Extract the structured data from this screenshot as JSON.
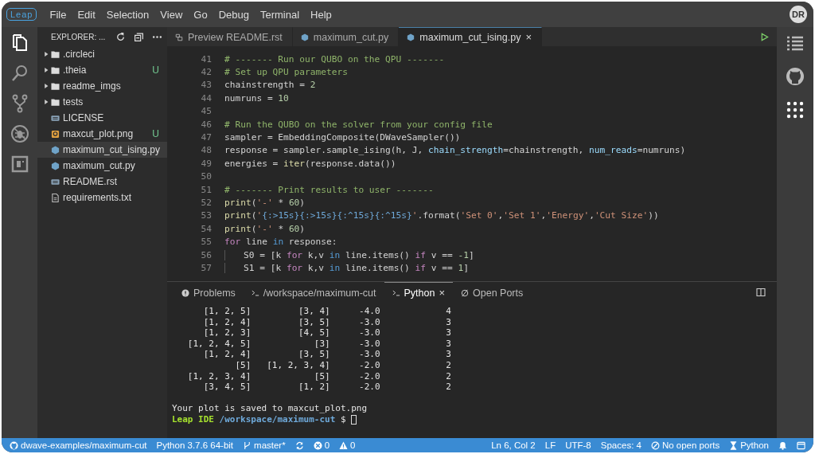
{
  "title_bar": {
    "logo": "Leap",
    "menu": [
      "File",
      "Edit",
      "Selection",
      "View",
      "Go",
      "Debug",
      "Terminal",
      "Help"
    ],
    "avatar": "DR"
  },
  "activity_bar": [
    {
      "kind": "explorer",
      "selected": true
    },
    {
      "kind": "search",
      "selected": false
    },
    {
      "kind": "source_control",
      "selected": false
    },
    {
      "kind": "debug",
      "selected": false
    },
    {
      "kind": "extensions",
      "selected": false
    }
  ],
  "explorer": {
    "title": "EXPLORER: ...",
    "items": [
      {
        "kind": "folder",
        "name": ".circleci",
        "expanded": false,
        "selected": false
      },
      {
        "kind": "folder",
        "name": ".theia",
        "expanded": false,
        "selected": false,
        "badge": "U"
      },
      {
        "kind": "folder",
        "name": "readme_imgs",
        "expanded": false,
        "selected": false
      },
      {
        "kind": "folder",
        "name": "tests",
        "expanded": false,
        "selected": false
      },
      {
        "kind": "text",
        "name": "LICENSE",
        "selected": false
      },
      {
        "kind": "image",
        "name": "maxcut_plot.png",
        "selected": false,
        "badge": "U"
      },
      {
        "kind": "python",
        "name": "maximum_cut_ising.py",
        "selected": true
      },
      {
        "kind": "python",
        "name": "maximum_cut.py",
        "selected": false
      },
      {
        "kind": "text",
        "name": "README.rst",
        "selected": false
      },
      {
        "kind": "plain",
        "name": "requirements.txt",
        "selected": false
      }
    ]
  },
  "editor_tabs": [
    {
      "kind": "preview",
      "label": "Preview README.rst",
      "selected": false
    },
    {
      "kind": "python",
      "label": "maximum_cut.py",
      "selected": false
    },
    {
      "kind": "python",
      "label": "maximum_cut_ising.py",
      "selected": true,
      "close": "×"
    }
  ],
  "code_lines": [
    {
      "number": "41",
      "tokens": [
        {
          "kind": "comment",
          "text": "# ------- Run our QUBO on the QPU -------"
        }
      ]
    },
    {
      "number": "42",
      "tokens": [
        {
          "kind": "comment",
          "text": "# Set up QPU parameters"
        }
      ]
    },
    {
      "number": "43",
      "tokens": [
        {
          "kind": "plain",
          "text": "chainstrength = "
        },
        {
          "kind": "number",
          "text": "2"
        }
      ]
    },
    {
      "number": "44",
      "tokens": [
        {
          "kind": "plain",
          "text": "numruns = "
        },
        {
          "kind": "number",
          "text": "10"
        }
      ]
    },
    {
      "number": "45"
    },
    {
      "number": "46",
      "tokens": [
        {
          "kind": "comment",
          "text": "# Run the QUBO on the solver from your config file"
        }
      ]
    },
    {
      "number": "47",
      "tokens": [
        {
          "kind": "plain",
          "text": "sampler = EmbeddingComposite(DWaveSampler())"
        }
      ]
    },
    {
      "number": "48",
      "tokens": [
        {
          "kind": "plain",
          "text": "response = sampler.sample_ising(h, J, "
        },
        {
          "kind": "param",
          "text": "chain_strength"
        },
        {
          "kind": "plain",
          "text": "=chainstrength, "
        },
        {
          "kind": "param",
          "text": "num_reads"
        },
        {
          "kind": "plain",
          "text": "=numruns)"
        }
      ]
    },
    {
      "number": "49",
      "tokens": [
        {
          "kind": "plain",
          "text": "energies = "
        },
        {
          "kind": "builtin",
          "text": "iter"
        },
        {
          "kind": "plain",
          "text": "(response.data())"
        }
      ]
    },
    {
      "number": "50"
    },
    {
      "number": "51",
      "tokens": [
        {
          "kind": "comment",
          "text": "# ------- Print results to user -------"
        }
      ]
    },
    {
      "number": "52",
      "tokens": [
        {
          "kind": "builtin",
          "text": "print"
        },
        {
          "kind": "plain",
          "text": "("
        },
        {
          "kind": "string",
          "text": "'-'"
        },
        {
          "kind": "plain",
          "text": " * "
        },
        {
          "kind": "number",
          "text": "60"
        },
        {
          "kind": "plain",
          "text": ")"
        }
      ]
    },
    {
      "number": "53",
      "tokens": [
        {
          "kind": "builtin",
          "text": "print"
        },
        {
          "kind": "plain",
          "text": "("
        },
        {
          "kind": "string",
          "text": "'"
        },
        {
          "kind": "format",
          "text": "{:>15s}{:>15s}{:^15s}{:^15s}"
        },
        {
          "kind": "string",
          "text": "'"
        },
        {
          "kind": "plain",
          "text": ".format("
        },
        {
          "kind": "string",
          "text": "'Set 0'"
        },
        {
          "kind": "plain",
          "text": ","
        },
        {
          "kind": "string",
          "text": "'Set 1'"
        },
        {
          "kind": "plain",
          "text": ","
        },
        {
          "kind": "string",
          "text": "'Energy'"
        },
        {
          "kind": "plain",
          "text": ","
        },
        {
          "kind": "string",
          "text": "'Cut Size'"
        },
        {
          "kind": "plain",
          "text": "))"
        }
      ]
    },
    {
      "number": "54",
      "tokens": [
        {
          "kind": "builtin",
          "text": "print"
        },
        {
          "kind": "plain",
          "text": "("
        },
        {
          "kind": "string",
          "text": "'-'"
        },
        {
          "kind": "plain",
          "text": " * "
        },
        {
          "kind": "number",
          "text": "60"
        },
        {
          "kind": "plain",
          "text": ")"
        }
      ]
    },
    {
      "number": "55",
      "tokens": [
        {
          "kind": "keyword",
          "text": "for"
        },
        {
          "kind": "plain",
          "text": " line "
        },
        {
          "kind": "operator",
          "text": "in"
        },
        {
          "kind": "plain",
          "text": " response:"
        }
      ]
    },
    {
      "number": "56",
      "indent": true,
      "tokens": [
        {
          "kind": "plain",
          "text": "S0 = [k "
        },
        {
          "kind": "keyword",
          "text": "for"
        },
        {
          "kind": "plain",
          "text": " k,v "
        },
        {
          "kind": "operator",
          "text": "in"
        },
        {
          "kind": "plain",
          "text": " line.items() "
        },
        {
          "kind": "keyword",
          "text": "if"
        },
        {
          "kind": "plain",
          "text": " v == "
        },
        {
          "kind": "number",
          "text": "-1"
        },
        {
          "kind": "plain",
          "text": "]"
        }
      ]
    },
    {
      "number": "57",
      "indent": true,
      "tokens": [
        {
          "kind": "plain",
          "text": "S1 = [k "
        },
        {
          "kind": "keyword",
          "text": "for"
        },
        {
          "kind": "plain",
          "text": " k,v "
        },
        {
          "kind": "operator",
          "text": "in"
        },
        {
          "kind": "plain",
          "text": " line.items() "
        },
        {
          "kind": "keyword",
          "text": "if"
        },
        {
          "kind": "plain",
          "text": " v == "
        },
        {
          "kind": "number",
          "text": "1"
        },
        {
          "kind": "plain",
          "text": "]"
        }
      ]
    }
  ],
  "panel_tabs": [
    {
      "kind": "problems",
      "label": "Problems",
      "selected": false
    },
    {
      "kind": "terminal",
      "label": "/workspace/maximum-cut",
      "selected": false
    },
    {
      "kind": "terminal",
      "label": "Python",
      "selected": true,
      "close": "×"
    },
    {
      "kind": "ports",
      "label": "Open Ports",
      "selected": false
    }
  ],
  "terminal": {
    "rows": [
      [
        "[1, 2, 5]",
        "[3, 4]",
        "-4.0",
        "4"
      ],
      [
        "[1, 2, 4]",
        "[3, 5]",
        "-3.0",
        "3"
      ],
      [
        "[1, 2, 3]",
        "[4, 5]",
        "-3.0",
        "3"
      ],
      [
        "[1, 2, 4, 5]",
        "[3]",
        "-3.0",
        "3"
      ],
      [
        "[1, 2, 4]",
        "[3, 5]",
        "-3.0",
        "3"
      ],
      [
        "[5]",
        "[1, 2, 3, 4]",
        "-2.0",
        "2"
      ],
      [
        "[1, 2, 3, 4]",
        "[5]",
        "-2.0",
        "2"
      ],
      [
        "[3, 4, 5]",
        "[1, 2]",
        "-2.0",
        "2"
      ]
    ],
    "message": "Your plot is saved to maxcut_plot.png",
    "prompt": [
      {
        "kind": "host",
        "text": "Leap IDE"
      },
      {
        "kind": "path",
        "text": "/workspace/maximum-cut"
      },
      {
        "kind": "symbol",
        "text": "$"
      }
    ]
  },
  "status_bar": {
    "left": [
      {
        "kind": "repo",
        "text": "dwave-examples/maximum-cut"
      },
      {
        "kind": "interpreter",
        "text": "Python 3.7.6 64-bit"
      },
      {
        "kind": "branch",
        "text": "master*"
      },
      {
        "kind": "sync"
      },
      {
        "kind": "errors",
        "text": "0"
      },
      {
        "kind": "warnings",
        "text": "0"
      }
    ],
    "right": [
      {
        "kind": "position",
        "text": "Ln 6, Col 2"
      },
      {
        "kind": "eol",
        "text": "LF"
      },
      {
        "kind": "encoding",
        "text": "UTF-8"
      },
      {
        "kind": "indent",
        "text": "Spaces: 4"
      },
      {
        "kind": "ports",
        "text": "No open ports"
      },
      {
        "kind": "language",
        "text": "Python"
      },
      {
        "kind": "notifications"
      },
      {
        "kind": "layout"
      }
    ]
  }
}
